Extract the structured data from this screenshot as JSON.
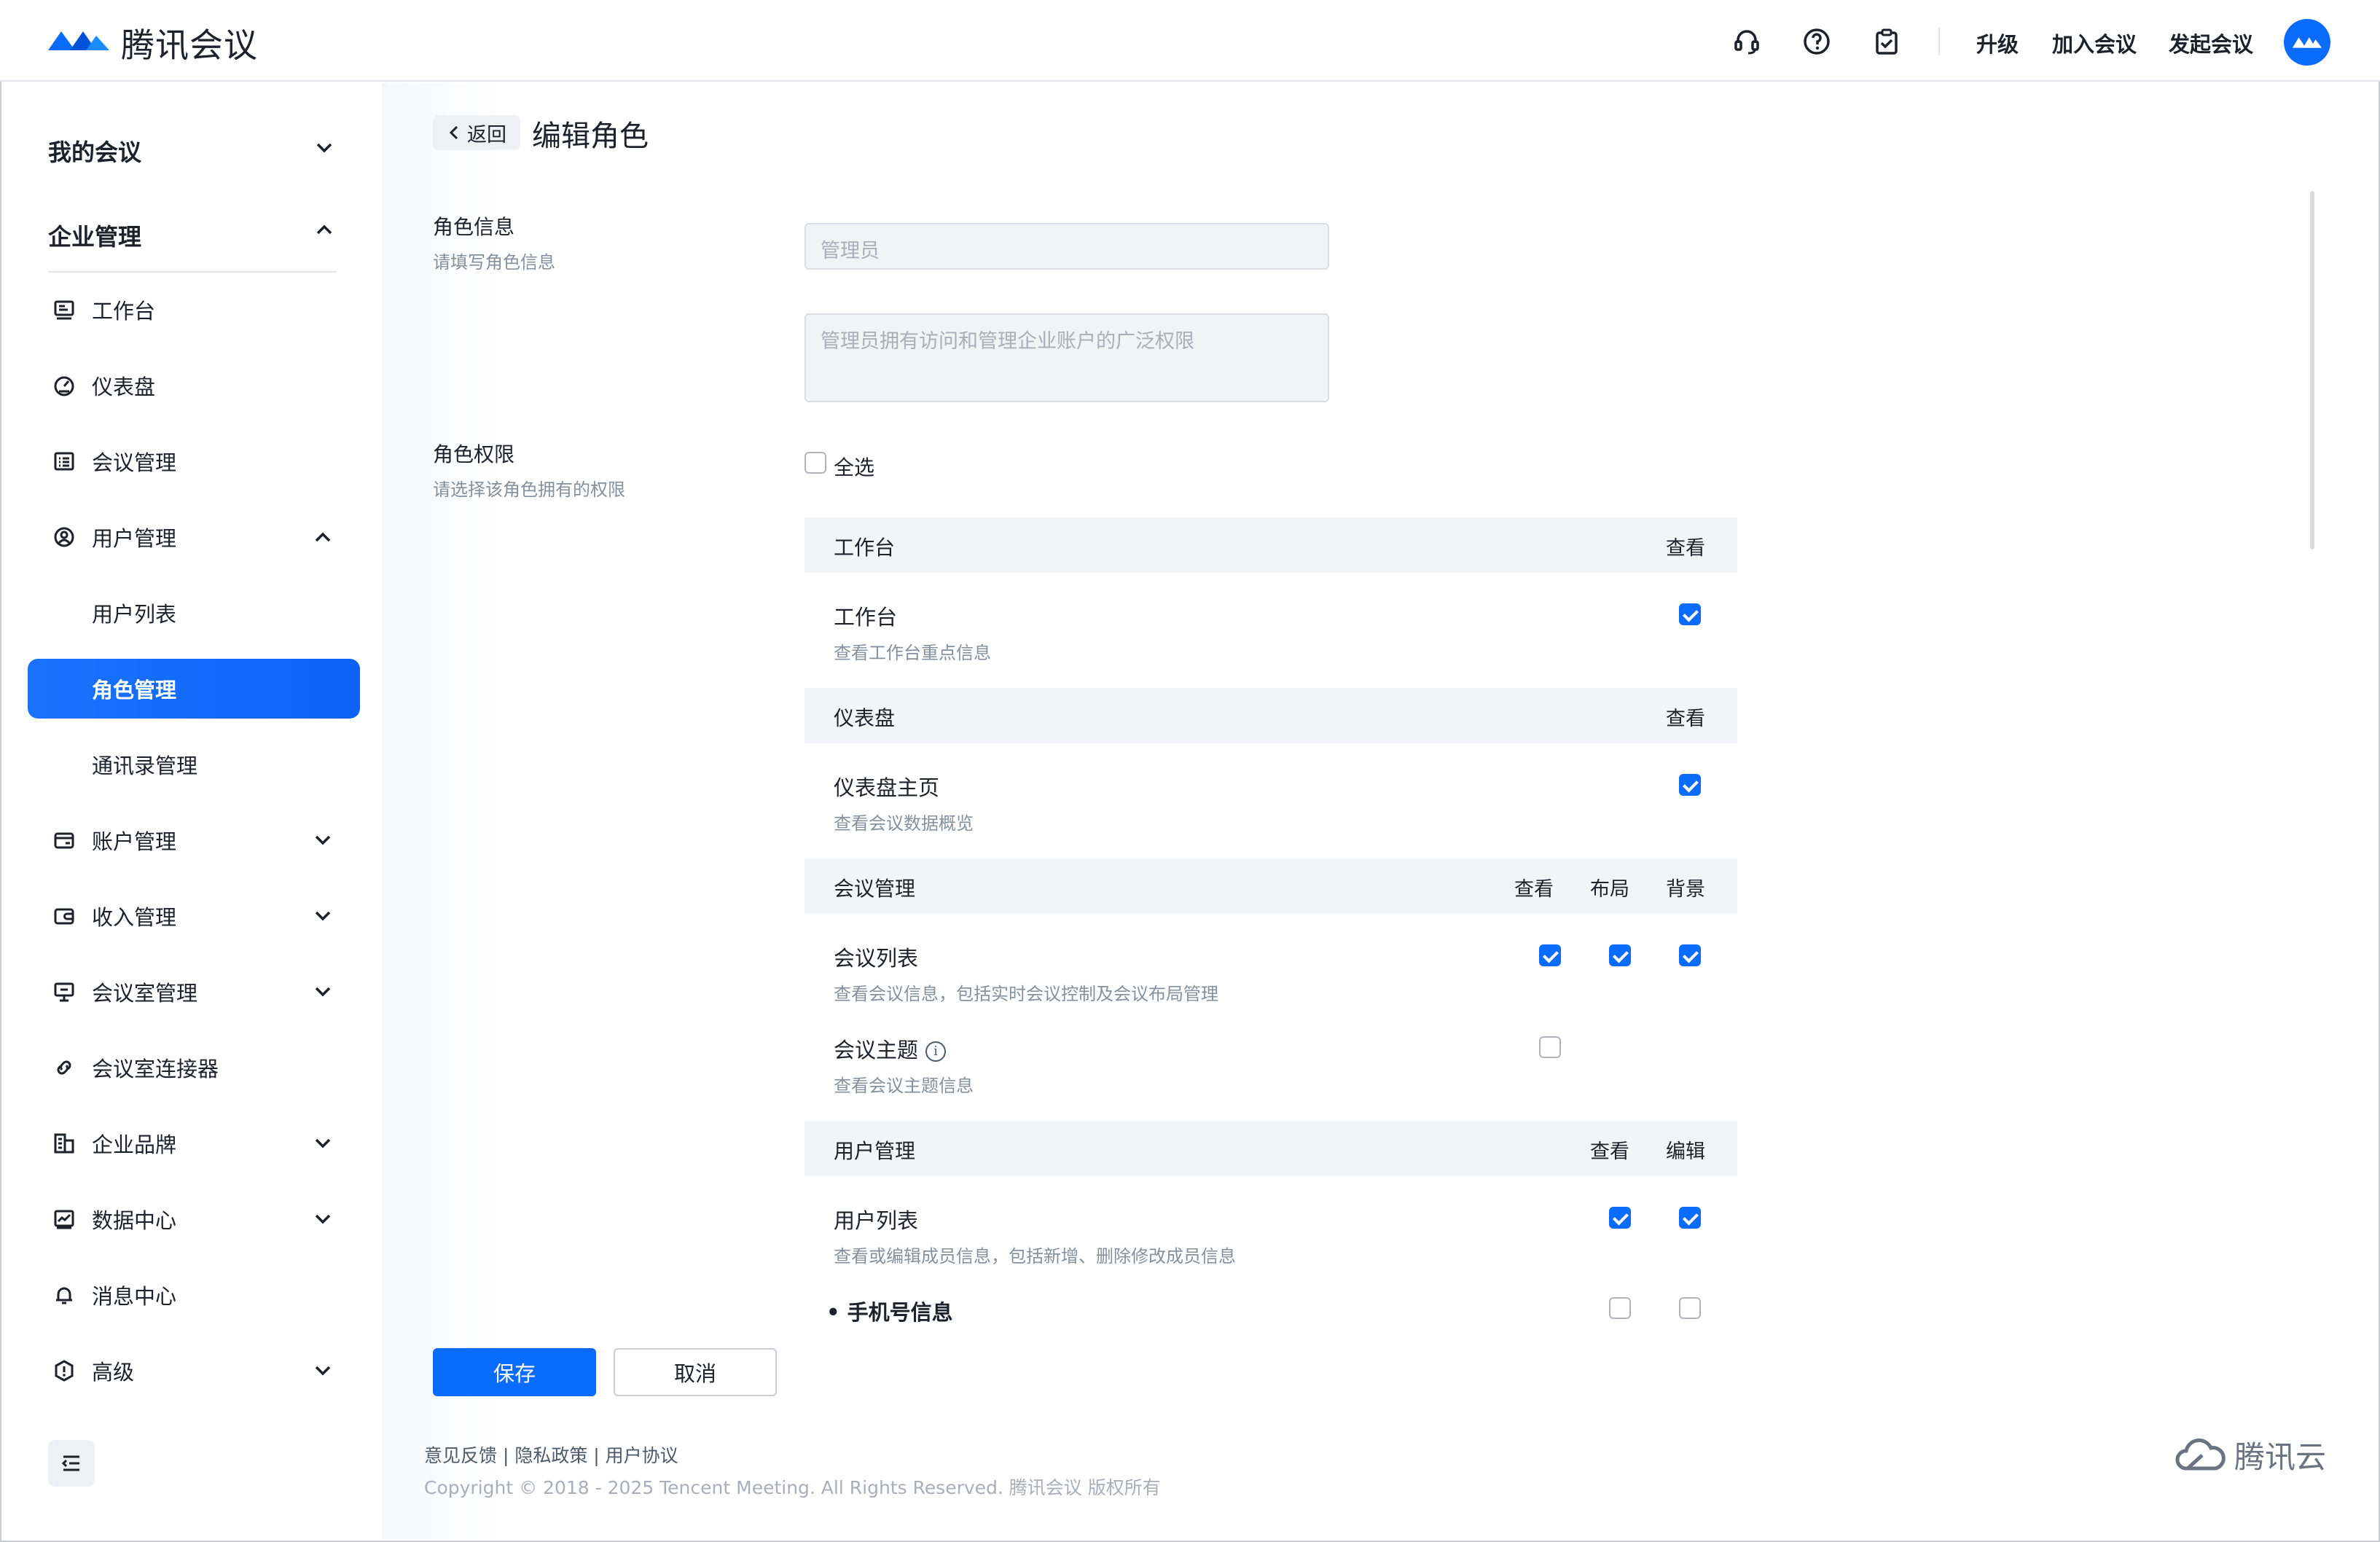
{
  "header": {
    "app_name": "腾讯会议",
    "links": {
      "upgrade": "升级",
      "join": "加入会议",
      "start": "发起会议"
    }
  },
  "sidebar": {
    "my_meetings": "我的会议",
    "enterprise": "企业管理",
    "items": [
      {
        "label": "工作台",
        "icon": "workbench-icon"
      },
      {
        "label": "仪表盘",
        "icon": "dashboard-icon"
      },
      {
        "label": "会议管理",
        "icon": "meeting-list-icon"
      },
      {
        "label": "用户管理",
        "icon": "user-icon"
      },
      {
        "label": "用户列表"
      },
      {
        "label": "角色管理"
      },
      {
        "label": "通讯录管理"
      },
      {
        "label": "账户管理",
        "icon": "account-icon"
      },
      {
        "label": "收入管理",
        "icon": "income-icon"
      },
      {
        "label": "会议室管理",
        "icon": "room-icon"
      },
      {
        "label": "会议室连接器",
        "icon": "link-icon"
      },
      {
        "label": "企业品牌",
        "icon": "brand-icon"
      },
      {
        "label": "数据中心",
        "icon": "chart-icon"
      },
      {
        "label": "消息中心",
        "icon": "bell-icon"
      },
      {
        "label": "高级",
        "icon": "advanced-icon"
      }
    ]
  },
  "page": {
    "back": "返回",
    "title": "编辑角色",
    "role_info": {
      "label": "角色信息",
      "hint": "请填写角色信息",
      "name_value": "管理员",
      "desc_value": "管理员拥有访问和管理企业账户的广泛权限"
    },
    "role_perm": {
      "label": "角色权限",
      "hint": "请选择该角色拥有的权限",
      "select_all": "全选"
    },
    "groups": [
      {
        "title": "工作台",
        "cols": [
          "查看"
        ],
        "rows": [
          {
            "title": "工作台",
            "desc": "查看工作台重点信息",
            "checks": [
              true
            ]
          }
        ]
      },
      {
        "title": "仪表盘",
        "cols": [
          "查看"
        ],
        "rows": [
          {
            "title": "仪表盘主页",
            "desc": "查看会议数据概览",
            "checks": [
              true
            ]
          }
        ]
      },
      {
        "title": "会议管理",
        "cols": [
          "查看",
          "布局",
          "背景"
        ],
        "rows": [
          {
            "title": "会议列表",
            "desc": "查看会议信息，包括实时会议控制及会议布局管理",
            "checks": [
              true,
              true,
              true
            ]
          },
          {
            "title": "会议主题",
            "desc": "查看会议主题信息",
            "checks": [
              false
            ]
          }
        ]
      },
      {
        "title": "用户管理",
        "cols": [
          "查看",
          "编辑"
        ],
        "rows": [
          {
            "title": "用户列表",
            "desc": "查看或编辑成员信息，包括新增、删除修改成员信息",
            "checks": [
              true,
              true
            ]
          },
          {
            "title": "• 手机号信息",
            "checks": [
              false,
              false
            ]
          }
        ]
      }
    ],
    "save": "保存",
    "cancel": "取消"
  },
  "footer": {
    "links": "意见反馈 | 隐私政策 | 用户协议",
    "copyright": "Copyright © 2018 - 2025 Tencent Meeting. All Rights Reserved. 腾讯会议 版权所有",
    "brand": "腾讯云"
  },
  "colors": {
    "accent": "#0a6cff",
    "muted": "#86909c"
  }
}
